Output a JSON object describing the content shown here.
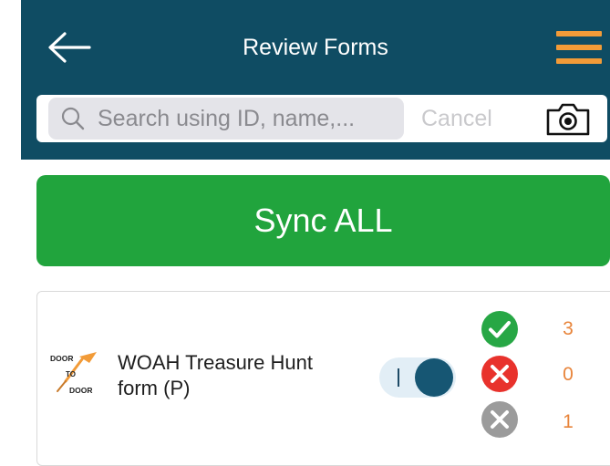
{
  "header": {
    "title": "Review Forms",
    "back_icon": "arrow-left-icon",
    "menu_icon": "hamburger-menu-icon"
  },
  "search": {
    "placeholder": "Search using ID, name,...",
    "cancel_label": "Cancel",
    "camera_icon": "camera-icon"
  },
  "sync": {
    "label": "Sync ALL"
  },
  "form": {
    "name": "WOAH Treasure Hunt form (P)",
    "toggle_on": true,
    "logo": {
      "text_top": "DOOR",
      "text_mid": "TO",
      "text_bottom": "DOOR"
    },
    "stats": [
      {
        "name": "synced",
        "icon": "check-circle-icon",
        "count": "3"
      },
      {
        "name": "failed",
        "icon": "error-circle-icon",
        "count": "0"
      },
      {
        "name": "pending",
        "icon": "pending-circle-icon",
        "count": "1"
      }
    ]
  },
  "colors": {
    "header_bg": "#0f4c63",
    "accent_orange": "#f29b38",
    "sync_green": "#21a43d",
    "success_green": "#27a745",
    "error_red": "#e8322c",
    "pending_gray": "#9b9b9b",
    "count_orange": "#e8843a"
  }
}
